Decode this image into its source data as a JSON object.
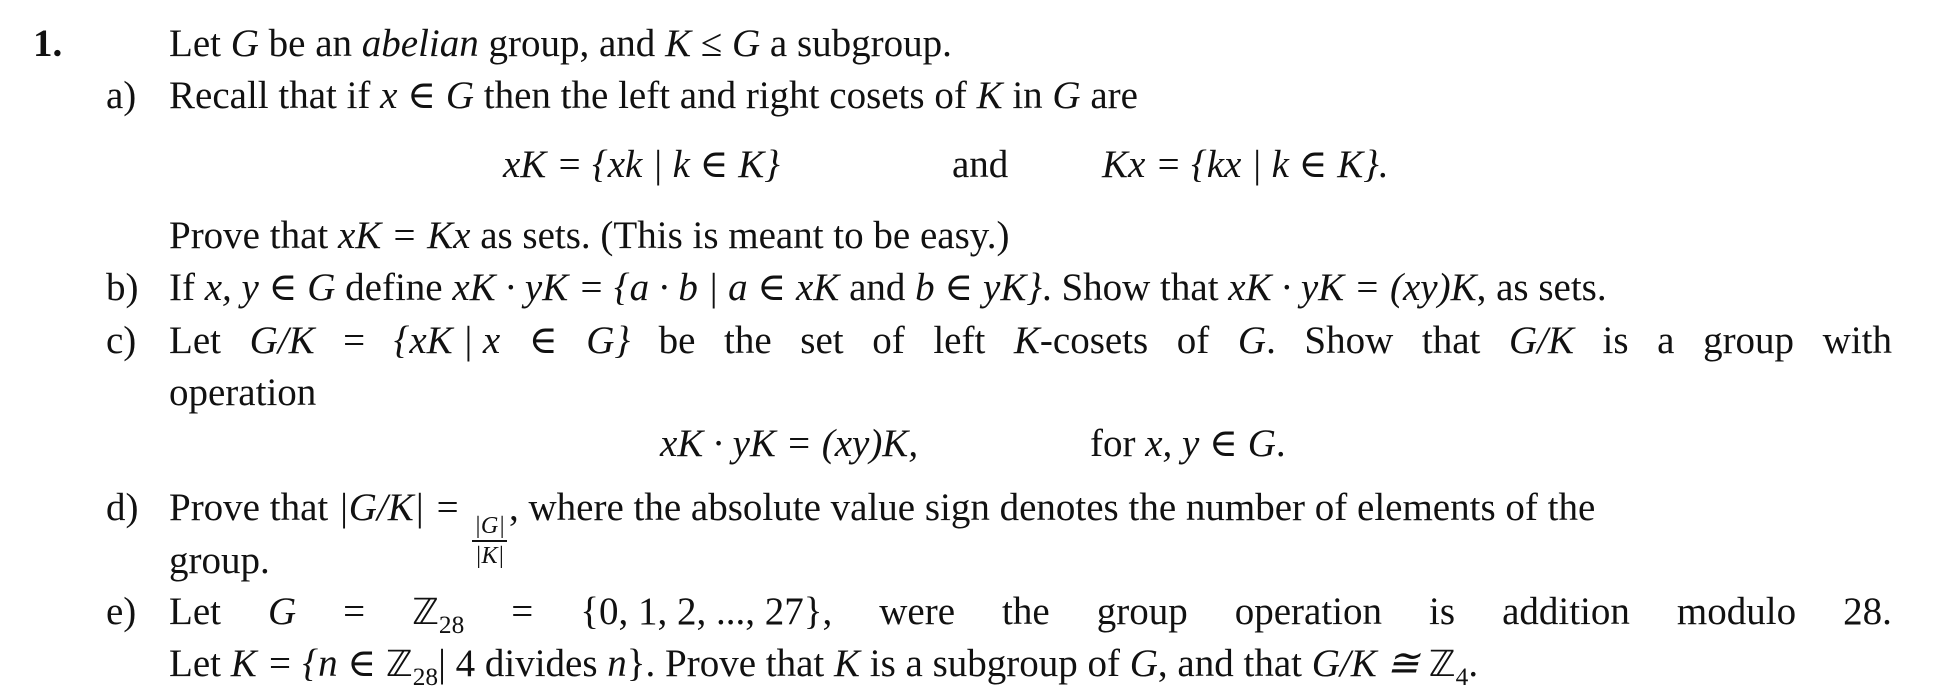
{
  "problem": {
    "number": "1.",
    "intro": {
      "p1": "Let ",
      "G": "G",
      "p2": " be an ",
      "abelian": "abelian",
      "p3": " group, and ",
      "K": "K",
      "rel": " ≤ ",
      "G2": "G",
      "p4": " a subgroup."
    },
    "parts": {
      "a": {
        "label": "a)",
        "line1": {
          "p1": "Recall that if ",
          "x": "x",
          "in": " ∈ ",
          "G": "G",
          "p2": " then the left and right cosets of ",
          "K": "K",
          "p3": " in ",
          "G2": "G",
          "p4": " are"
        },
        "display": {
          "left": "xK = {xk | k ∈ K}",
          "mid": "and",
          "right": "Kx = {kx | k ∈ K}."
        },
        "line2": {
          "p1": "Prove that ",
          "eq": "xK = Kx",
          "p2": " as sets. (This is meant to be easy.)"
        }
      },
      "b": {
        "label": "b)",
        "p1": "If ",
        "m1": "x, y ∈ G",
        "p2": " define ",
        "m2": "xK · yK = {a · b | a ∈ xK",
        "p3": " and ",
        "m3": "b ∈ yK}",
        "p4": ". Show that ",
        "m4": "xK · yK = (xy)K",
        "p5": ", as sets."
      },
      "c": {
        "label": "c)",
        "words": [
          "Let",
          "G/K",
          "=",
          "{xK | x",
          "∈",
          "G}",
          "be",
          "the",
          "set",
          "of",
          "left",
          "K-cosets",
          "of",
          "G.",
          "Show",
          "that",
          "G/K",
          "is",
          "a",
          "group",
          "with"
        ],
        "line2": "operation",
        "display": {
          "left": "xK · yK = (xy)K,",
          "right_text": "for ",
          "right_math": "x, y ∈ G",
          "right_end": "."
        }
      },
      "d": {
        "label": "d)",
        "p1": "Prove that ",
        "m1": "|G/K| = ",
        "num": "|G|",
        "den": "|K|",
        "p2": ", where the absolute value sign denotes the number of elements of the",
        "line2": "group."
      },
      "e": {
        "label": "e)",
        "line1": [
          "Let",
          "G",
          "=",
          "ℤ",
          "=",
          "{0, 1, 2, ..., 27},",
          "were",
          "the",
          "group",
          "operation",
          "is",
          "addition",
          "modulo",
          "28."
        ],
        "sub28": "28",
        "line2": {
          "p1": "Let ",
          "m1": "K = {n ∈ ",
          "Z": "ℤ",
          "sub": "28",
          "m2": "| 4 divides ",
          "n": "n",
          "m3": "}",
          "p2": ". Prove that ",
          "K": "K",
          "p3": " is a subgroup of ",
          "G": "G",
          "p4": ", and that ",
          "m4": "G/K ≅ ",
          "Z4": "ℤ",
          "sub4": "4",
          "end": "."
        }
      }
    }
  }
}
